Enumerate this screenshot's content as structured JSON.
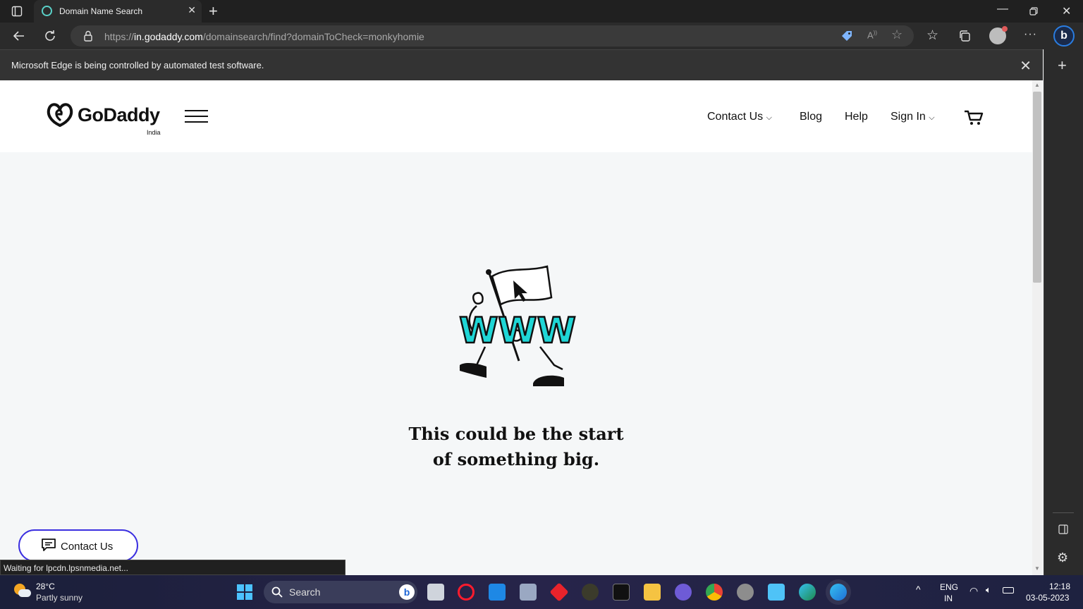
{
  "browser": {
    "tab_title": "Domain Name Search",
    "url_prefix": "https://",
    "url_host": "in.godaddy.com",
    "url_path": "/domainsearch/find?domainToCheck=monkyhomie",
    "infobar_text": "Microsoft Edge is being controlled by automated test software.",
    "status_text": "Waiting for lpcdn.lpsnmedia.net..."
  },
  "site": {
    "logo": "GoDaddy",
    "logo_region": "India",
    "nav": {
      "contact": "Contact Us",
      "blog": "Blog",
      "help": "Help",
      "signin": "Sign In"
    },
    "hero_word": "WWW",
    "tagline_line1": "This could be the start",
    "tagline_line2": "of something big.",
    "contact_button": "Contact Us"
  },
  "taskbar": {
    "weather_temp": "28°C",
    "weather_desc": "Partly sunny",
    "search_label": "Search",
    "lang_line1": "ENG",
    "lang_line2": "IN",
    "time": "12:18",
    "date": "03-05-2023"
  },
  "colors": {
    "brand_teal": "#1fd6d6",
    "contact_border": "#3b2fe0"
  }
}
